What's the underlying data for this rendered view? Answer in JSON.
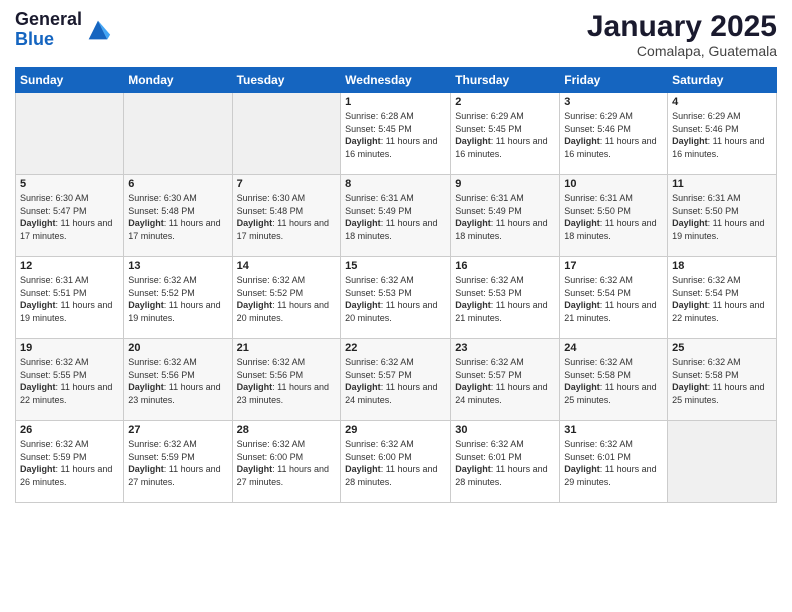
{
  "header": {
    "logo_general": "General",
    "logo_blue": "Blue",
    "month_title": "January 2025",
    "location": "Comalapa, Guatemala"
  },
  "days_of_week": [
    "Sunday",
    "Monday",
    "Tuesday",
    "Wednesday",
    "Thursday",
    "Friday",
    "Saturday"
  ],
  "weeks": [
    [
      {
        "day": "",
        "info": ""
      },
      {
        "day": "",
        "info": ""
      },
      {
        "day": "",
        "info": ""
      },
      {
        "day": "1",
        "info": "Sunrise: 6:28 AM\nSunset: 5:45 PM\nDaylight: 11 hours and 16 minutes."
      },
      {
        "day": "2",
        "info": "Sunrise: 6:29 AM\nSunset: 5:45 PM\nDaylight: 11 hours and 16 minutes."
      },
      {
        "day": "3",
        "info": "Sunrise: 6:29 AM\nSunset: 5:46 PM\nDaylight: 11 hours and 16 minutes."
      },
      {
        "day": "4",
        "info": "Sunrise: 6:29 AM\nSunset: 5:46 PM\nDaylight: 11 hours and 16 minutes."
      }
    ],
    [
      {
        "day": "5",
        "info": "Sunrise: 6:30 AM\nSunset: 5:47 PM\nDaylight: 11 hours and 17 minutes."
      },
      {
        "day": "6",
        "info": "Sunrise: 6:30 AM\nSunset: 5:48 PM\nDaylight: 11 hours and 17 minutes."
      },
      {
        "day": "7",
        "info": "Sunrise: 6:30 AM\nSunset: 5:48 PM\nDaylight: 11 hours and 17 minutes."
      },
      {
        "day": "8",
        "info": "Sunrise: 6:31 AM\nSunset: 5:49 PM\nDaylight: 11 hours and 18 minutes."
      },
      {
        "day": "9",
        "info": "Sunrise: 6:31 AM\nSunset: 5:49 PM\nDaylight: 11 hours and 18 minutes."
      },
      {
        "day": "10",
        "info": "Sunrise: 6:31 AM\nSunset: 5:50 PM\nDaylight: 11 hours and 18 minutes."
      },
      {
        "day": "11",
        "info": "Sunrise: 6:31 AM\nSunset: 5:50 PM\nDaylight: 11 hours and 19 minutes."
      }
    ],
    [
      {
        "day": "12",
        "info": "Sunrise: 6:31 AM\nSunset: 5:51 PM\nDaylight: 11 hours and 19 minutes."
      },
      {
        "day": "13",
        "info": "Sunrise: 6:32 AM\nSunset: 5:52 PM\nDaylight: 11 hours and 19 minutes."
      },
      {
        "day": "14",
        "info": "Sunrise: 6:32 AM\nSunset: 5:52 PM\nDaylight: 11 hours and 20 minutes."
      },
      {
        "day": "15",
        "info": "Sunrise: 6:32 AM\nSunset: 5:53 PM\nDaylight: 11 hours and 20 minutes."
      },
      {
        "day": "16",
        "info": "Sunrise: 6:32 AM\nSunset: 5:53 PM\nDaylight: 11 hours and 21 minutes."
      },
      {
        "day": "17",
        "info": "Sunrise: 6:32 AM\nSunset: 5:54 PM\nDaylight: 11 hours and 21 minutes."
      },
      {
        "day": "18",
        "info": "Sunrise: 6:32 AM\nSunset: 5:54 PM\nDaylight: 11 hours and 22 minutes."
      }
    ],
    [
      {
        "day": "19",
        "info": "Sunrise: 6:32 AM\nSunset: 5:55 PM\nDaylight: 11 hours and 22 minutes."
      },
      {
        "day": "20",
        "info": "Sunrise: 6:32 AM\nSunset: 5:56 PM\nDaylight: 11 hours and 23 minutes."
      },
      {
        "day": "21",
        "info": "Sunrise: 6:32 AM\nSunset: 5:56 PM\nDaylight: 11 hours and 23 minutes."
      },
      {
        "day": "22",
        "info": "Sunrise: 6:32 AM\nSunset: 5:57 PM\nDaylight: 11 hours and 24 minutes."
      },
      {
        "day": "23",
        "info": "Sunrise: 6:32 AM\nSunset: 5:57 PM\nDaylight: 11 hours and 24 minutes."
      },
      {
        "day": "24",
        "info": "Sunrise: 6:32 AM\nSunset: 5:58 PM\nDaylight: 11 hours and 25 minutes."
      },
      {
        "day": "25",
        "info": "Sunrise: 6:32 AM\nSunset: 5:58 PM\nDaylight: 11 hours and 25 minutes."
      }
    ],
    [
      {
        "day": "26",
        "info": "Sunrise: 6:32 AM\nSunset: 5:59 PM\nDaylight: 11 hours and 26 minutes."
      },
      {
        "day": "27",
        "info": "Sunrise: 6:32 AM\nSunset: 5:59 PM\nDaylight: 11 hours and 27 minutes."
      },
      {
        "day": "28",
        "info": "Sunrise: 6:32 AM\nSunset: 6:00 PM\nDaylight: 11 hours and 27 minutes."
      },
      {
        "day": "29",
        "info": "Sunrise: 6:32 AM\nSunset: 6:00 PM\nDaylight: 11 hours and 28 minutes."
      },
      {
        "day": "30",
        "info": "Sunrise: 6:32 AM\nSunset: 6:01 PM\nDaylight: 11 hours and 28 minutes."
      },
      {
        "day": "31",
        "info": "Sunrise: 6:32 AM\nSunset: 6:01 PM\nDaylight: 11 hours and 29 minutes."
      },
      {
        "day": "",
        "info": ""
      }
    ]
  ]
}
